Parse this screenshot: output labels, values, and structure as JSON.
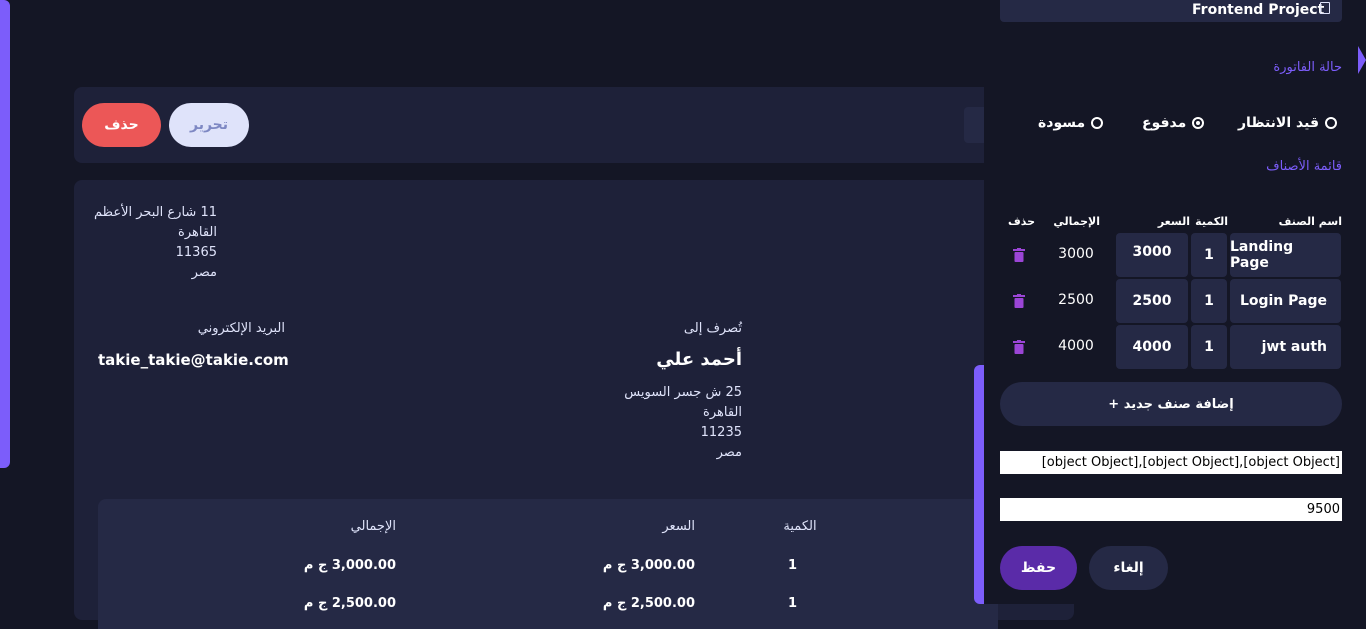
{
  "invoice": {
    "actions": {
      "delete_label": "حذف",
      "edit_label": "تحرير"
    },
    "sender_address": [
      "11 شارع البحر الأعظم",
      "القاهرة",
      "11365",
      "مصر"
    ],
    "email_label": "البريد الإلكتروني",
    "email_value": "takie_takie@takie.com",
    "bill_to_label": "تُصرف إلى",
    "client_name": "أحمد علي",
    "client_address": [
      "25 ش جسر السويس",
      "القاهرة",
      "11235",
      "مصر"
    ],
    "items_table": {
      "headers": {
        "qty": "الكمية",
        "price": "السعر",
        "total": "الإجمالي"
      },
      "rows": [
        {
          "qty": "1",
          "price": "3,000.00 ج م",
          "total": "3,000.00 ج م"
        },
        {
          "qty": "1",
          "price": "2,500.00 ج م",
          "total": "2,500.00 ج م"
        }
      ]
    }
  },
  "edit_panel": {
    "project_field": "Frontend Project",
    "status_label": "حالة الفاتورة",
    "status_options": [
      {
        "label": "قيد الانتظار",
        "selected": false
      },
      {
        "label": "مدفوع",
        "selected": true
      },
      {
        "label": "مسودة",
        "selected": false
      }
    ],
    "items_label": "قائمة الأصناف",
    "item_headers": {
      "name": "اسم الصنف",
      "qty": "الكمية",
      "price": "السعر",
      "total": "الإجمالي",
      "delete": "حذف"
    },
    "items": [
      {
        "name": "Landing Page",
        "qty": "1",
        "price": "3000",
        "total": "3000"
      },
      {
        "name": "Login Page",
        "qty": "1",
        "price": "2500",
        "total": "2500"
      },
      {
        "name": "jwt auth",
        "qty": "1",
        "price": "4000",
        "total": "4000"
      }
    ],
    "add_item_label": "+ إضافة صنف جديد",
    "items_debug_value": "[object Object],[object Object],[object Object]",
    "total_value": "9500",
    "save_label": "حفظ",
    "cancel_label": "إلغاء"
  },
  "colors": {
    "accent": "#7c5dfa",
    "danger": "#ec5757",
    "card": "#1e2139",
    "background": "#141625"
  }
}
